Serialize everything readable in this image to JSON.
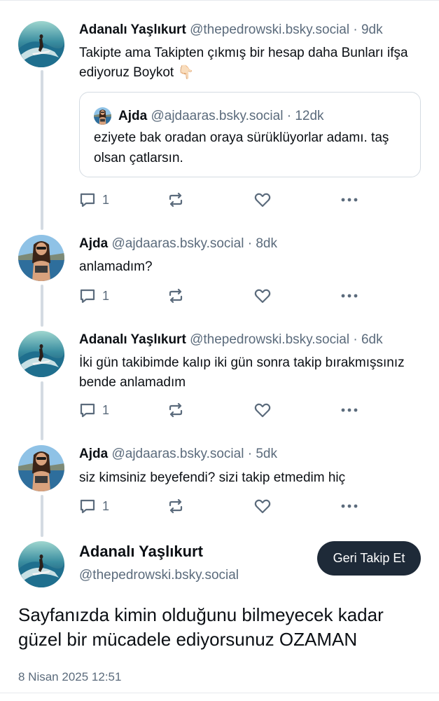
{
  "posts": [
    {
      "author": "Adanalı Yaşlıkurt",
      "handle": "@thepedrowski.bsky.social",
      "time": "9dk",
      "text": "Takipte ama Takipten çıkmış bir hesap daha Bunları ifşa ediyoruz Boykot 👇🏻",
      "avatar": "surfer-avatar",
      "quote": {
        "author": "Ajda",
        "handle": "@ajdaaras.bsky.social",
        "time": "12dk",
        "text": "eziyete bak oradan oraya sürüklüyorlar adamı. taş olsan çatlarsın."
      },
      "reply_count": "1"
    },
    {
      "author": "Ajda",
      "handle": "@ajdaaras.bsky.social",
      "time": "8dk",
      "text": "anlamadım?",
      "avatar": "woman-beach-avatar",
      "reply_count": "1"
    },
    {
      "author": "Adanalı Yaşlıkurt",
      "handle": "@thepedrowski.bsky.social",
      "time": "6dk",
      "text": "İki gün takibimde kalıp iki gün sonra takip bırakmışsınız bende anlamadım",
      "avatar": "surfer-avatar",
      "reply_count": "1"
    },
    {
      "author": "Ajda",
      "handle": "@ajdaaras.bsky.social",
      "time": "5dk",
      "text": "siz kimsiniz beyefendi? sizi takip etmedim hiç",
      "avatar": "woman-beach-avatar",
      "reply_count": "1"
    }
  ],
  "separator": "·",
  "main": {
    "author": "Adanalı Yaşlıkurt",
    "handle": "@thepedrowski.bsky.social",
    "follow_label": "Geri Takip Et",
    "text": "Sayfanızda kimin olduğunu bilmeyecek kadar güzel bir mücadele ediyorsunuz OZAMAN",
    "date": "8 Nisan 2025 12:51",
    "avatar": "surfer-avatar"
  },
  "icons": {
    "reply": "reply-icon",
    "repost": "repost-icon",
    "like": "heart-icon",
    "more": "more-icon"
  },
  "colors": {
    "text": "#0b0f14",
    "muted": "#5b6b7c",
    "thread_line": "#d4dbe2",
    "button": "#1e2a38"
  }
}
